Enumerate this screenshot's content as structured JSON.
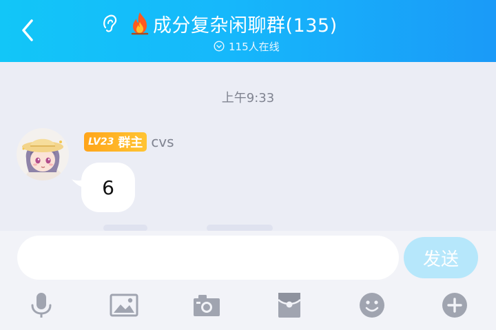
{
  "header": {
    "title": "成分复杂闲聊群(135)",
    "online": "115人在线",
    "icons": [
      "back-arrow-icon",
      "ear-icon",
      "fire-icon",
      "chevron-down-circle-icon"
    ],
    "colors": {
      "gradient_start": "#12c6f8",
      "gradient_end": "#1a9af8"
    }
  },
  "chat": {
    "timestamp": "上午9:33",
    "messages": [
      {
        "level": "LV23",
        "role": "群主",
        "sender": "cvs",
        "text": "6",
        "badge_color": "#ffa51a"
      }
    ]
  },
  "input": {
    "value": "",
    "send_label": "发送",
    "send_color": "#b6e7fb"
  },
  "toolbar": {
    "items": [
      "microphone-icon",
      "image-icon",
      "camera-icon",
      "red-packet-icon",
      "emoji-icon",
      "plus-icon"
    ]
  }
}
